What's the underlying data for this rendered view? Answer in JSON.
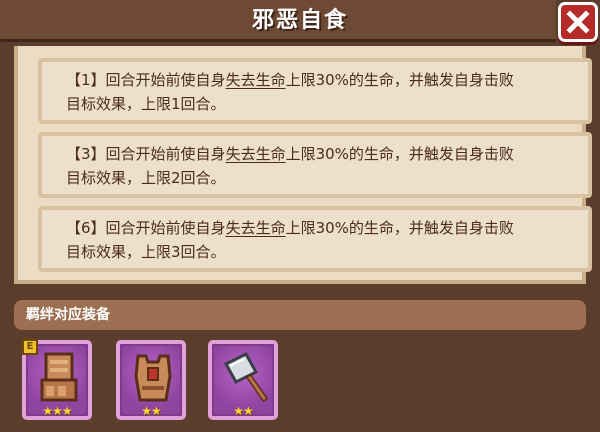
{
  "title": "邪恶自食",
  "close_icon": "close-icon",
  "effects": [
    {
      "level": "【1】",
      "pre": "回合开始前使自身",
      "term": "失去生命",
      "post": "上限30%的生命，并触发自身击败",
      "line2": "目标效果，上限1回合。"
    },
    {
      "level": "【3】",
      "pre": "回合开始前使自身",
      "term": "失去生命",
      "post": "上限30%的生命，并触发自身击败",
      "line2": "目标效果，上限2回合。"
    },
    {
      "level": "【6】",
      "pre": "回合开始前使自身",
      "term": "失去生命",
      "post": "上限30%的生命，并触发自身击败",
      "line2": "目标效果，上限3回合。"
    }
  ],
  "equipment": {
    "title": "羁绊对应装备",
    "items": [
      {
        "icon": "gauntlet-icon",
        "stars": "★★★",
        "badge": "E"
      },
      {
        "icon": "armor-icon",
        "stars": "★★"
      },
      {
        "icon": "cleaver-icon",
        "stars": "★★"
      }
    ]
  }
}
